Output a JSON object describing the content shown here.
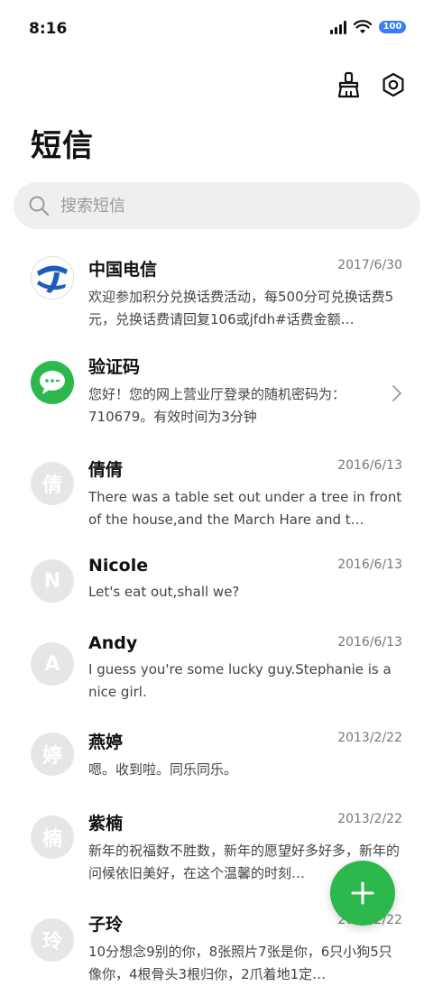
{
  "status": {
    "time": "8:16",
    "battery": "100"
  },
  "header": {
    "title": "短信"
  },
  "search": {
    "placeholder": "搜索短信"
  },
  "messages": [
    {
      "name": "中国电信",
      "date": "2017/6/30",
      "preview": "欢迎参加积分兑换话费活动，每500分可兑换话费5元，兑换话费请回复106或jfdh#话费金额…",
      "avatar": "telecom-logo"
    },
    {
      "name": "验证码",
      "date": "",
      "preview": "您好！您的网上营业厅登录的随机密码为：710679。有效时间为3分钟",
      "avatar": "message-bubble-icon"
    },
    {
      "name": "倩倩",
      "date": "2016/6/13",
      "preview": "There was a table set out under a tree in front of the house,and the March Hare and t…",
      "avatar_letter": "倩"
    },
    {
      "name": "Nicole",
      "date": "2016/6/13",
      "preview": "Let's eat out,shall we?",
      "avatar_letter": "N"
    },
    {
      "name": "Andy",
      "date": "2016/6/13",
      "preview": "I guess you're some lucky guy.Stephanie is a nice girl.",
      "avatar_letter": "A"
    },
    {
      "name": "燕婷",
      "date": "2013/2/22",
      "preview": "嗯。收到啦。同乐同乐。",
      "avatar_letter": "婷"
    },
    {
      "name": "紫楠",
      "date": "2013/2/22",
      "preview": "新年的祝福数不胜数，新年的愿望好多好多，新年的问候依旧美好，在这个温馨的时刻…",
      "avatar_letter": "楠"
    },
    {
      "name": "子玲",
      "date": "2013/2/22",
      "preview": "10分想念9别的你，8张照片7张是你，6只小狗5只像你，4根骨头3根归你，2爪着地1定…",
      "avatar_letter": "玲"
    }
  ],
  "colors": {
    "accent": "#2db84d",
    "battery": "#3b7cff",
    "telecom_blue": "#1f5bb8"
  }
}
